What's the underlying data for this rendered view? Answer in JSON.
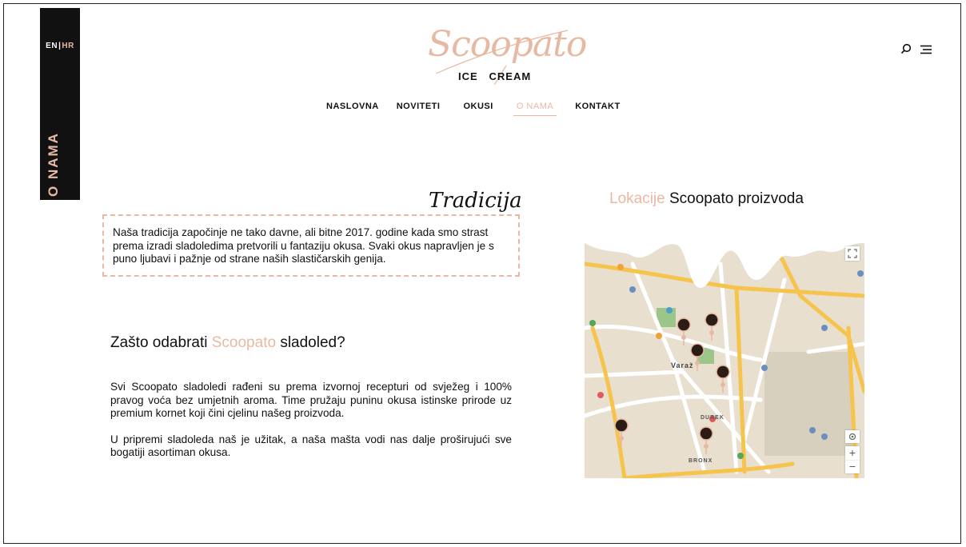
{
  "language": {
    "en": "EN",
    "separator": "|",
    "hr": "HR"
  },
  "sidebar": {
    "section_label": "O NAMA"
  },
  "logo": {
    "script": "Scoopato",
    "sub_left": "ICE",
    "sub_right": "CREAM"
  },
  "nav": {
    "items": [
      {
        "label": "NASLOVNA"
      },
      {
        "label": "NOVITETI"
      },
      {
        "label": "OKUSI"
      },
      {
        "label": "O NAMA",
        "active": true
      },
      {
        "label": "KONTAKT"
      }
    ]
  },
  "header_icons": {
    "search": "search-icon",
    "menu": "menu-icon"
  },
  "tradicija": {
    "title": "Tradicija",
    "text": "Naša tradicija započinje ne tako davne, ali bitne 2017. godine kada smo strast prema izradi sladoledima pretvorili u fantaziju okusa. Svaki okus napravljen je s puno ljubavi i pažnje od strane naših slastičarskih genija."
  },
  "why": {
    "title_pre": "Zašto odabrati ",
    "title_accent": "Scoopato",
    "title_post": " sladoled?",
    "p1": "Svi Scoopato sladoledi rađeni su prema izvornoj recepturi od svježeg i 100% pravog voća bez umjetnih aroma. Time pružaju puninu okusa istinske prirode uz premium kornet koji čini cjelinu našeg proizvoda.",
    "p2": "U pripremi sladoleda naš je užitak, a naša mašta vodi nas dalje proširujući sve bogatiji asortiman okusa."
  },
  "locations": {
    "title_accent": "Lokacije",
    "title_rest": " Scoopato proizvoda"
  },
  "map": {
    "district_labels": [
      "Varaž",
      "DUREK",
      "BRONX"
    ],
    "zoom_in": "+",
    "zoom_out": "−"
  },
  "colors": {
    "accent": "#e8b9a2",
    "dark": "#111111",
    "map_bg": "#e8dfcf",
    "road": "#f6c44c"
  }
}
